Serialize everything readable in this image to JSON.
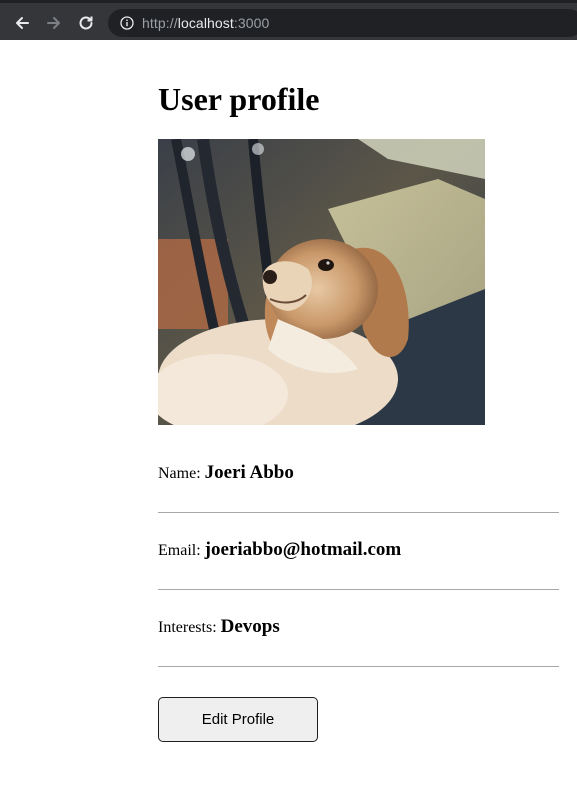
{
  "browser": {
    "url_scheme": "http://",
    "url_host": "localhost",
    "url_port": ":3000"
  },
  "page": {
    "title": "User profile",
    "fields": [
      {
        "label": "Name:",
        "value": "Joeri Abbo"
      },
      {
        "label": "Email:",
        "value": "joeriabbo@hotmail.com"
      },
      {
        "label": "Interests:",
        "value": "Devops"
      }
    ],
    "edit_button_label": "Edit Profile"
  }
}
